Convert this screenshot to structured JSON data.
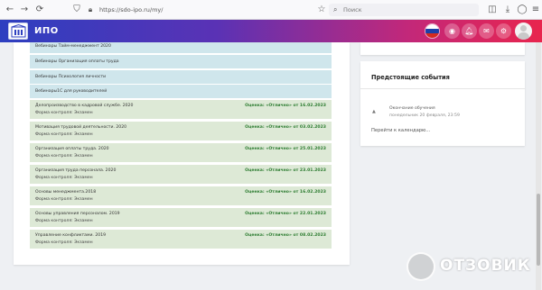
{
  "browser": {
    "url": "https://sdo-ipo.ru/my/",
    "search_placeholder": "Поиск"
  },
  "header": {
    "app_title": "ИПО",
    "flag_colors": [
      "#ffffff",
      "#1c3fa8",
      "#d52b1e"
    ]
  },
  "course_rows": [
    {
      "title": "Вебинары Тайм-менеджмент 2020",
      "style": "blue"
    },
    {
      "title": "Вебинары Организация оплаты труда",
      "style": "blue"
    },
    {
      "title": "Вебинары Психология личности",
      "style": "blue"
    },
    {
      "title": "Вебинары1С для руководителей",
      "style": "blue"
    },
    {
      "title": "Делопроизводство в кадровой службе. 2020",
      "grade": "Оценка: «Отлично» от 16.02.2023",
      "form": "Форма контроля: Экзамен",
      "style": "green"
    },
    {
      "title": "Мотивация трудовой деятельности. 2020",
      "grade": "Оценка: «Отлично» от 03.02.2023",
      "form": "Форма контроля: Экзамен",
      "style": "green"
    },
    {
      "title": "Организация оплаты труда. 2020",
      "grade": "Оценка: «Отлично» от 25.01.2023",
      "form": "Форма контроля: Экзамен",
      "style": "green"
    },
    {
      "title": "Организация труда персонала. 2020",
      "grade": "Оценка: «Отлично» от 23.01.2023",
      "form": "Форма контроля: Экзамен",
      "style": "green"
    },
    {
      "title": "Основы менеджмента.2018",
      "grade": "Оценка: «Отлично» от 16.02.2023",
      "form": "Форма контроля: Экзамен",
      "style": "green"
    },
    {
      "title": "Основы управления персоналом. 2019",
      "grade": "Оценка: «Отлично» от 22.01.2023",
      "form": "Форма контроля: Экзамен",
      "style": "green"
    },
    {
      "title": "Управление конфликтами. 2019",
      "grade": "Оценка: «Отлично» от 08.02.2023",
      "form": "Форма контроля: Экзамен",
      "style": "green"
    }
  ],
  "events": {
    "title": "Предстоящие события",
    "event_name": "Окончание обучения",
    "event_date": "понедельник 20 февраля, 23:59",
    "calendar_link": "Перейти к календарю..."
  },
  "watermark": {
    "text": "ОТЗОВИК"
  }
}
